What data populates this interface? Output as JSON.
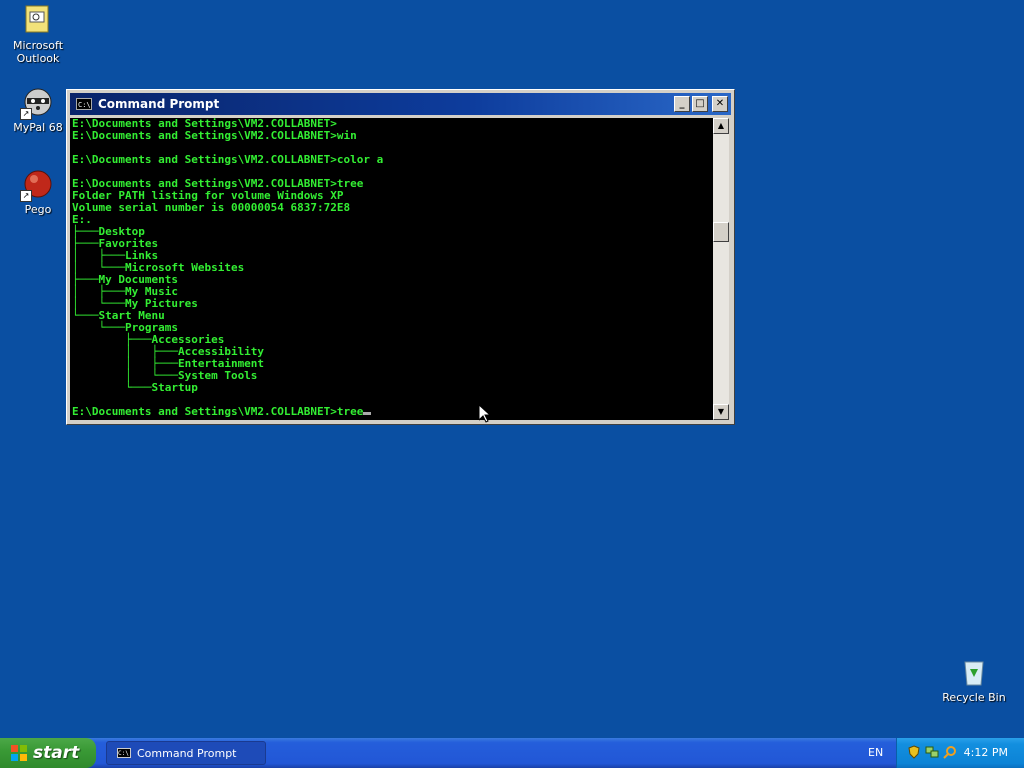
{
  "desktop": {
    "icons": [
      {
        "label": "Microsoft Outlook",
        "label_line1": "Microsoft",
        "label_line2": "Outlook"
      },
      {
        "label": "MyPal 68"
      },
      {
        "label": "Pego"
      },
      {
        "label": "Recycle Bin"
      }
    ]
  },
  "window": {
    "title": "Command Prompt",
    "icon_text": "C:\\",
    "buttons": {
      "minimize": "_",
      "maximize": "□",
      "close": "✕"
    },
    "lines": [
      "E:\\Documents and Settings\\VM2.COLLABNET>",
      "E:\\Documents and Settings\\VM2.COLLABNET>win",
      "",
      "E:\\Documents and Settings\\VM2.COLLABNET>color a",
      "",
      "E:\\Documents and Settings\\VM2.COLLABNET>tree",
      "Folder PATH listing for volume Windows XP",
      "Volume serial number is 00000054 6837:72E8",
      "E:.",
      "├───Desktop",
      "├───Favorites",
      "│   ├───Links",
      "│   └───Microsoft Websites",
      "├───My Documents",
      "│   ├───My Music",
      "│   └───My Pictures",
      "└───Start Menu",
      "    └───Programs",
      "        ├───Accessories",
      "        │   ├───Accessibility",
      "        │   ├───Entertainment",
      "        │   └───System Tools",
      "        └───Startup",
      ""
    ],
    "prompt_line": "E:\\Documents and Settings\\VM2.COLLABNET>tree",
    "scroll_up": "▲",
    "scroll_down": "▼"
  },
  "taskbar": {
    "start_label": "start",
    "task_label": "Command Prompt",
    "task_icon_text": "C:\\",
    "language": "EN",
    "clock": "4:12 PM"
  },
  "colors": {
    "desktop": "#0a4fa2",
    "console_text": "#33ee33",
    "title_bar": "#0a246a"
  }
}
